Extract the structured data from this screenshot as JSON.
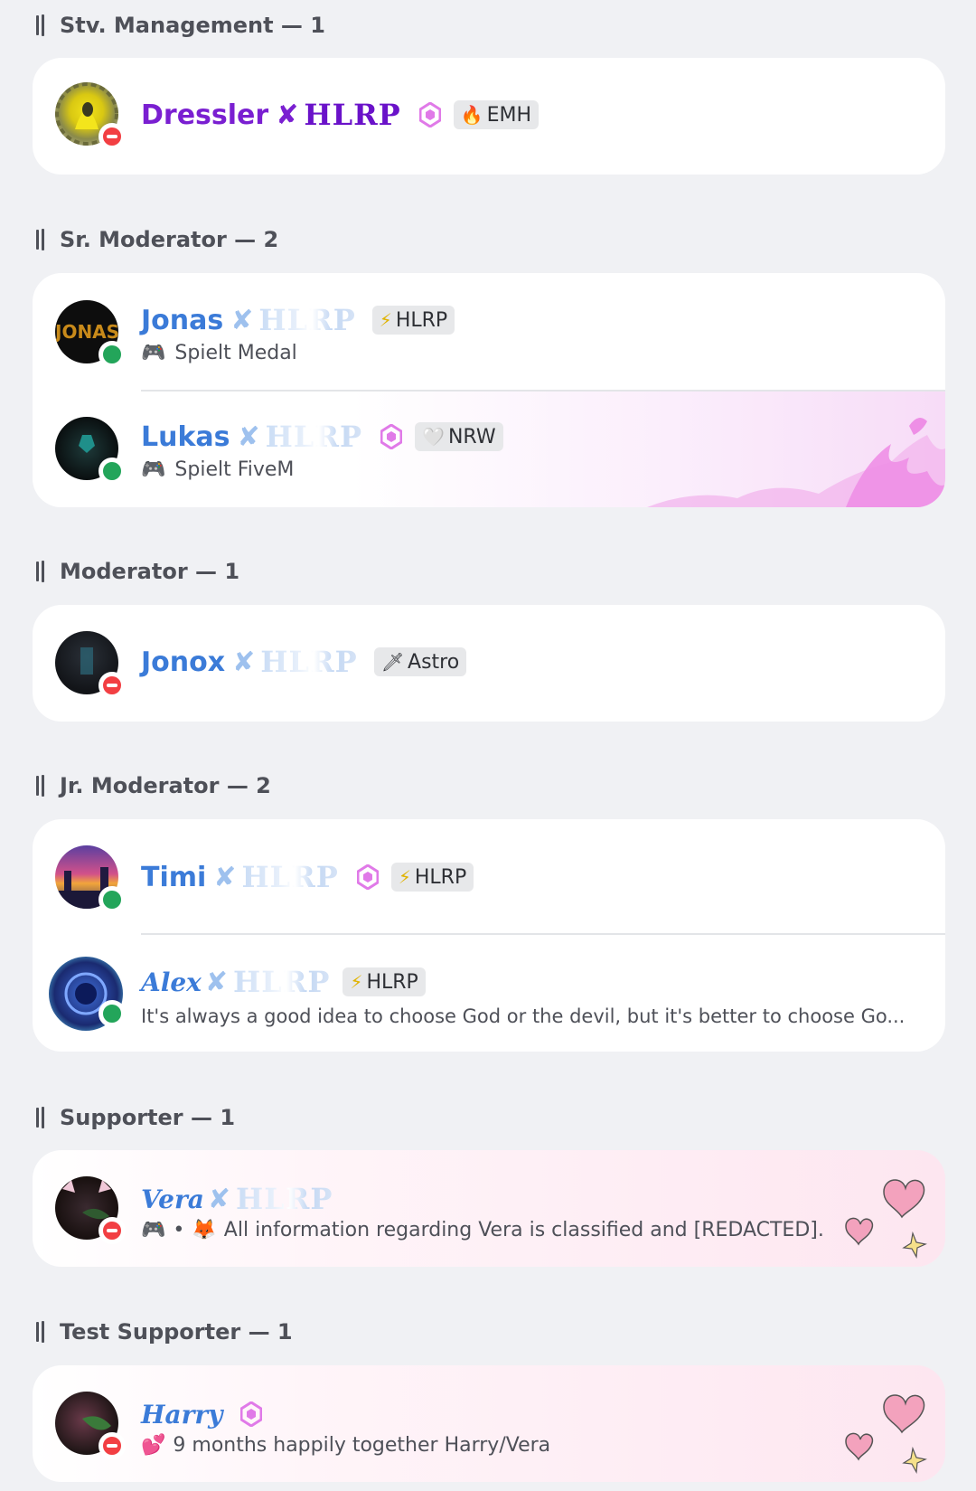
{
  "sections": [
    {
      "header": "Stv. Management — 1",
      "members": [
        {
          "name": "Dressler",
          "tag": "HLRP",
          "badge_icon": "fire-icon",
          "badge": "EMH",
          "name_color": "#7a1fd1",
          "status": "dnd"
        }
      ]
    },
    {
      "header": "Sr. Moderator — 2",
      "members": [
        {
          "name": "Jonas",
          "tag": "HLRP",
          "badge_icon": "lightning-icon",
          "badge": "HLRP",
          "activity": "Spielt Medal",
          "name_color": "#3b7bd8",
          "status": "online"
        },
        {
          "name": "Lukas",
          "tag": "HLRP",
          "badge_icon": "heart-outline-icon",
          "badge": "NRW",
          "activity": "Spielt FiveM",
          "name_color": "#3b7bd8",
          "status": "online"
        }
      ]
    },
    {
      "header": "Moderator — 1",
      "members": [
        {
          "name": "Jonox",
          "tag": "HLRP",
          "badge_icon": "sword-icon",
          "badge": "Astro",
          "name_color": "#3b7bd8",
          "status": "dnd"
        }
      ]
    },
    {
      "header": "Jr. Moderator — 2",
      "members": [
        {
          "name": "Timi",
          "tag": "HLRP",
          "badge_icon": "lightning-icon",
          "badge": "HLRP",
          "name_color": "#3b7bd8",
          "status": "online"
        },
        {
          "name": "Alex",
          "tag": "HLRP",
          "badge_icon": "lightning-icon",
          "badge": "HLRP",
          "activity": "It's always a good idea to choose God or the devil, but it's better to choose Go...",
          "name_color": "#3b7bd8",
          "status": "online"
        }
      ]
    },
    {
      "header": "Supporter — 1",
      "members": [
        {
          "name": "Vera",
          "tag": "HLRP",
          "activity": "All information regarding Vera is classified and [REDACTED].",
          "name_color": "#3b7bd8",
          "status": "dnd"
        }
      ]
    },
    {
      "header": "Test Supporter — 1",
      "members": [
        {
          "name": "Harry",
          "activity": "9 months happily together Harry/Vera",
          "name_color": "#3b7bd8",
          "status": "dnd"
        }
      ]
    }
  ],
  "colors": {
    "background": "#f0f1f4",
    "card": "#ffffff",
    "online": "#23a55a",
    "dnd": "#f23f43",
    "gem": "#e07ae8"
  }
}
